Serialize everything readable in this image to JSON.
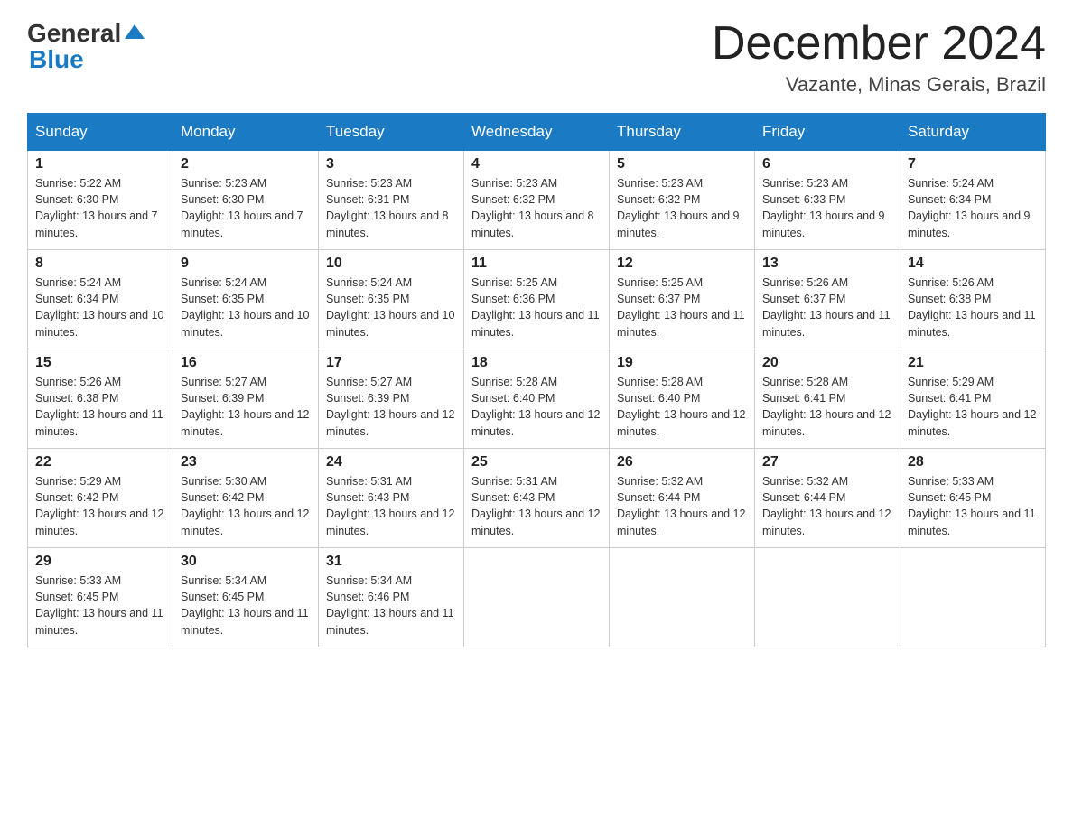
{
  "logo": {
    "general": "General",
    "blue": "Blue",
    "triangle_color": "#1a7bc4"
  },
  "title": {
    "month_year": "December 2024",
    "location": "Vazante, Minas Gerais, Brazil"
  },
  "headers": [
    "Sunday",
    "Monday",
    "Tuesday",
    "Wednesday",
    "Thursday",
    "Friday",
    "Saturday"
  ],
  "weeks": [
    [
      {
        "day": "1",
        "sunrise": "5:22 AM",
        "sunset": "6:30 PM",
        "daylight": "13 hours and 7 minutes."
      },
      {
        "day": "2",
        "sunrise": "5:23 AM",
        "sunset": "6:30 PM",
        "daylight": "13 hours and 7 minutes."
      },
      {
        "day": "3",
        "sunrise": "5:23 AM",
        "sunset": "6:31 PM",
        "daylight": "13 hours and 8 minutes."
      },
      {
        "day": "4",
        "sunrise": "5:23 AM",
        "sunset": "6:32 PM",
        "daylight": "13 hours and 8 minutes."
      },
      {
        "day": "5",
        "sunrise": "5:23 AM",
        "sunset": "6:32 PM",
        "daylight": "13 hours and 9 minutes."
      },
      {
        "day": "6",
        "sunrise": "5:23 AM",
        "sunset": "6:33 PM",
        "daylight": "13 hours and 9 minutes."
      },
      {
        "day": "7",
        "sunrise": "5:24 AM",
        "sunset": "6:34 PM",
        "daylight": "13 hours and 9 minutes."
      }
    ],
    [
      {
        "day": "8",
        "sunrise": "5:24 AM",
        "sunset": "6:34 PM",
        "daylight": "13 hours and 10 minutes."
      },
      {
        "day": "9",
        "sunrise": "5:24 AM",
        "sunset": "6:35 PM",
        "daylight": "13 hours and 10 minutes."
      },
      {
        "day": "10",
        "sunrise": "5:24 AM",
        "sunset": "6:35 PM",
        "daylight": "13 hours and 10 minutes."
      },
      {
        "day": "11",
        "sunrise": "5:25 AM",
        "sunset": "6:36 PM",
        "daylight": "13 hours and 11 minutes."
      },
      {
        "day": "12",
        "sunrise": "5:25 AM",
        "sunset": "6:37 PM",
        "daylight": "13 hours and 11 minutes."
      },
      {
        "day": "13",
        "sunrise": "5:26 AM",
        "sunset": "6:37 PM",
        "daylight": "13 hours and 11 minutes."
      },
      {
        "day": "14",
        "sunrise": "5:26 AM",
        "sunset": "6:38 PM",
        "daylight": "13 hours and 11 minutes."
      }
    ],
    [
      {
        "day": "15",
        "sunrise": "5:26 AM",
        "sunset": "6:38 PM",
        "daylight": "13 hours and 11 minutes."
      },
      {
        "day": "16",
        "sunrise": "5:27 AM",
        "sunset": "6:39 PM",
        "daylight": "13 hours and 12 minutes."
      },
      {
        "day": "17",
        "sunrise": "5:27 AM",
        "sunset": "6:39 PM",
        "daylight": "13 hours and 12 minutes."
      },
      {
        "day": "18",
        "sunrise": "5:28 AM",
        "sunset": "6:40 PM",
        "daylight": "13 hours and 12 minutes."
      },
      {
        "day": "19",
        "sunrise": "5:28 AM",
        "sunset": "6:40 PM",
        "daylight": "13 hours and 12 minutes."
      },
      {
        "day": "20",
        "sunrise": "5:28 AM",
        "sunset": "6:41 PM",
        "daylight": "13 hours and 12 minutes."
      },
      {
        "day": "21",
        "sunrise": "5:29 AM",
        "sunset": "6:41 PM",
        "daylight": "13 hours and 12 minutes."
      }
    ],
    [
      {
        "day": "22",
        "sunrise": "5:29 AM",
        "sunset": "6:42 PM",
        "daylight": "13 hours and 12 minutes."
      },
      {
        "day": "23",
        "sunrise": "5:30 AM",
        "sunset": "6:42 PM",
        "daylight": "13 hours and 12 minutes."
      },
      {
        "day": "24",
        "sunrise": "5:31 AM",
        "sunset": "6:43 PM",
        "daylight": "13 hours and 12 minutes."
      },
      {
        "day": "25",
        "sunrise": "5:31 AM",
        "sunset": "6:43 PM",
        "daylight": "13 hours and 12 minutes."
      },
      {
        "day": "26",
        "sunrise": "5:32 AM",
        "sunset": "6:44 PM",
        "daylight": "13 hours and 12 minutes."
      },
      {
        "day": "27",
        "sunrise": "5:32 AM",
        "sunset": "6:44 PM",
        "daylight": "13 hours and 12 minutes."
      },
      {
        "day": "28",
        "sunrise": "5:33 AM",
        "sunset": "6:45 PM",
        "daylight": "13 hours and 11 minutes."
      }
    ],
    [
      {
        "day": "29",
        "sunrise": "5:33 AM",
        "sunset": "6:45 PM",
        "daylight": "13 hours and 11 minutes."
      },
      {
        "day": "30",
        "sunrise": "5:34 AM",
        "sunset": "6:45 PM",
        "daylight": "13 hours and 11 minutes."
      },
      {
        "day": "31",
        "sunrise": "5:34 AM",
        "sunset": "6:46 PM",
        "daylight": "13 hours and 11 minutes."
      },
      null,
      null,
      null,
      null
    ]
  ]
}
